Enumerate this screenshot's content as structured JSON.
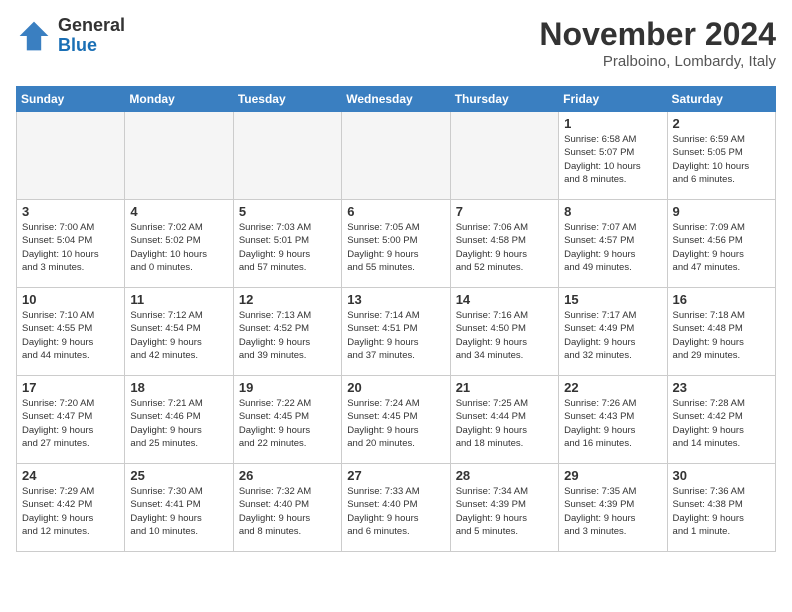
{
  "header": {
    "logo_general": "General",
    "logo_blue": "Blue",
    "month_title": "November 2024",
    "location": "Pralboino, Lombardy, Italy"
  },
  "days_of_week": [
    "Sunday",
    "Monday",
    "Tuesday",
    "Wednesday",
    "Thursday",
    "Friday",
    "Saturday"
  ],
  "weeks": [
    [
      {
        "day": "",
        "info": ""
      },
      {
        "day": "",
        "info": ""
      },
      {
        "day": "",
        "info": ""
      },
      {
        "day": "",
        "info": ""
      },
      {
        "day": "",
        "info": ""
      },
      {
        "day": "1",
        "info": "Sunrise: 6:58 AM\nSunset: 5:07 PM\nDaylight: 10 hours\nand 8 minutes."
      },
      {
        "day": "2",
        "info": "Sunrise: 6:59 AM\nSunset: 5:05 PM\nDaylight: 10 hours\nand 6 minutes."
      }
    ],
    [
      {
        "day": "3",
        "info": "Sunrise: 7:00 AM\nSunset: 5:04 PM\nDaylight: 10 hours\nand 3 minutes."
      },
      {
        "day": "4",
        "info": "Sunrise: 7:02 AM\nSunset: 5:02 PM\nDaylight: 10 hours\nand 0 minutes."
      },
      {
        "day": "5",
        "info": "Sunrise: 7:03 AM\nSunset: 5:01 PM\nDaylight: 9 hours\nand 57 minutes."
      },
      {
        "day": "6",
        "info": "Sunrise: 7:05 AM\nSunset: 5:00 PM\nDaylight: 9 hours\nand 55 minutes."
      },
      {
        "day": "7",
        "info": "Sunrise: 7:06 AM\nSunset: 4:58 PM\nDaylight: 9 hours\nand 52 minutes."
      },
      {
        "day": "8",
        "info": "Sunrise: 7:07 AM\nSunset: 4:57 PM\nDaylight: 9 hours\nand 49 minutes."
      },
      {
        "day": "9",
        "info": "Sunrise: 7:09 AM\nSunset: 4:56 PM\nDaylight: 9 hours\nand 47 minutes."
      }
    ],
    [
      {
        "day": "10",
        "info": "Sunrise: 7:10 AM\nSunset: 4:55 PM\nDaylight: 9 hours\nand 44 minutes."
      },
      {
        "day": "11",
        "info": "Sunrise: 7:12 AM\nSunset: 4:54 PM\nDaylight: 9 hours\nand 42 minutes."
      },
      {
        "day": "12",
        "info": "Sunrise: 7:13 AM\nSunset: 4:52 PM\nDaylight: 9 hours\nand 39 minutes."
      },
      {
        "day": "13",
        "info": "Sunrise: 7:14 AM\nSunset: 4:51 PM\nDaylight: 9 hours\nand 37 minutes."
      },
      {
        "day": "14",
        "info": "Sunrise: 7:16 AM\nSunset: 4:50 PM\nDaylight: 9 hours\nand 34 minutes."
      },
      {
        "day": "15",
        "info": "Sunrise: 7:17 AM\nSunset: 4:49 PM\nDaylight: 9 hours\nand 32 minutes."
      },
      {
        "day": "16",
        "info": "Sunrise: 7:18 AM\nSunset: 4:48 PM\nDaylight: 9 hours\nand 29 minutes."
      }
    ],
    [
      {
        "day": "17",
        "info": "Sunrise: 7:20 AM\nSunset: 4:47 PM\nDaylight: 9 hours\nand 27 minutes."
      },
      {
        "day": "18",
        "info": "Sunrise: 7:21 AM\nSunset: 4:46 PM\nDaylight: 9 hours\nand 25 minutes."
      },
      {
        "day": "19",
        "info": "Sunrise: 7:22 AM\nSunset: 4:45 PM\nDaylight: 9 hours\nand 22 minutes."
      },
      {
        "day": "20",
        "info": "Sunrise: 7:24 AM\nSunset: 4:45 PM\nDaylight: 9 hours\nand 20 minutes."
      },
      {
        "day": "21",
        "info": "Sunrise: 7:25 AM\nSunset: 4:44 PM\nDaylight: 9 hours\nand 18 minutes."
      },
      {
        "day": "22",
        "info": "Sunrise: 7:26 AM\nSunset: 4:43 PM\nDaylight: 9 hours\nand 16 minutes."
      },
      {
        "day": "23",
        "info": "Sunrise: 7:28 AM\nSunset: 4:42 PM\nDaylight: 9 hours\nand 14 minutes."
      }
    ],
    [
      {
        "day": "24",
        "info": "Sunrise: 7:29 AM\nSunset: 4:42 PM\nDaylight: 9 hours\nand 12 minutes."
      },
      {
        "day": "25",
        "info": "Sunrise: 7:30 AM\nSunset: 4:41 PM\nDaylight: 9 hours\nand 10 minutes."
      },
      {
        "day": "26",
        "info": "Sunrise: 7:32 AM\nSunset: 4:40 PM\nDaylight: 9 hours\nand 8 minutes."
      },
      {
        "day": "27",
        "info": "Sunrise: 7:33 AM\nSunset: 4:40 PM\nDaylight: 9 hours\nand 6 minutes."
      },
      {
        "day": "28",
        "info": "Sunrise: 7:34 AM\nSunset: 4:39 PM\nDaylight: 9 hours\nand 5 minutes."
      },
      {
        "day": "29",
        "info": "Sunrise: 7:35 AM\nSunset: 4:39 PM\nDaylight: 9 hours\nand 3 minutes."
      },
      {
        "day": "30",
        "info": "Sunrise: 7:36 AM\nSunset: 4:38 PM\nDaylight: 9 hours\nand 1 minute."
      }
    ]
  ]
}
